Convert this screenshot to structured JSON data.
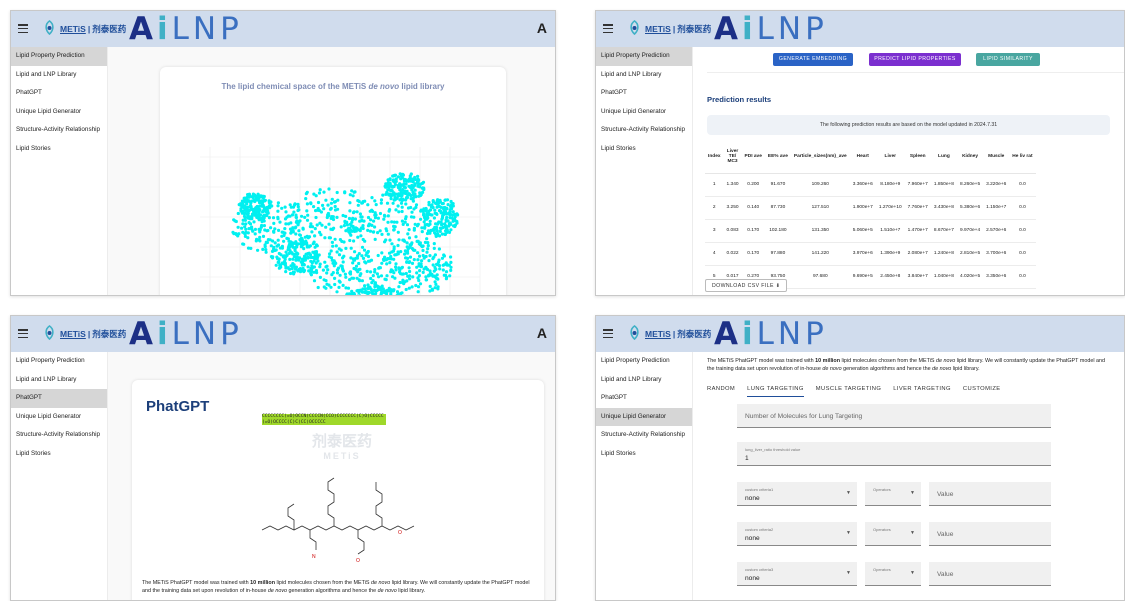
{
  "app": {
    "brand_en": "METiS",
    "brand_sep": "|",
    "brand_cn": "剂泰医药",
    "logo_text": "AiLNP",
    "account_icon": "A"
  },
  "sidebar": {
    "items": [
      {
        "label": "Lipid Property Prediction"
      },
      {
        "label": "Lipid and LNP Library"
      },
      {
        "label": "PhatGPT"
      },
      {
        "label": "Unique Lipid Generator"
      },
      {
        "label": "Structure-Activity Relationship"
      },
      {
        "label": "Lipid Stories"
      }
    ]
  },
  "panel1": {
    "chart_title_prefix": "The lipid chemical space of the METiS ",
    "chart_title_italic": "de novo",
    "chart_title_suffix": " lipid library",
    "point_color": "#00f0f0"
  },
  "panel2": {
    "buttons": [
      {
        "label": "GENERATE EMBEDDING",
        "color": "#2a63c6"
      },
      {
        "label": "PREDICT LIPID PROPERTIES",
        "color": "#7b2fcf"
      },
      {
        "label": "LIPID SIMILARITY",
        "color": "#49a6a0"
      }
    ],
    "results_title": "Prediction results",
    "info_text": "The following prediction results are based on the model updated in 2024.7.31",
    "table": {
      "headers": [
        "Index",
        "Liver TE/ MC3",
        "PDI ave",
        "EE% ave",
        "Particle_sizes(nm)_ave",
        "Heart",
        "Liver",
        "Spleen",
        "Lung",
        "Kidney",
        "Muscle",
        "He liv rat"
      ],
      "rows": [
        [
          "1",
          "1.340",
          "0.200",
          "91.670",
          "109.260",
          "3.360e+6",
          "8.180e+9",
          "7.960e+7",
          "1.850e+8",
          "8.260e+5",
          "3.220e+6",
          "0.0"
        ],
        [
          "2",
          "3.250",
          "0.140",
          "87.730",
          "127.510",
          "1.900e+7",
          "1.270e+10",
          "7.760e+7",
          "3.430e+8",
          "5.380e+6",
          "1.150e+7",
          "0.0"
        ],
        [
          "3",
          "0.083",
          "0.170",
          "102.180",
          "131.350",
          "5.060e+5",
          "1.510e+7",
          "1.470e+7",
          "8.670e+7",
          "9.970e+4",
          "2.570e+6",
          "0.0"
        ],
        [
          "4",
          "0.022",
          "0.170",
          "97.880",
          "141.220",
          "3.970e+6",
          "1.390e+9",
          "2.080e+7",
          "1.240e+8",
          "2.810e+5",
          "3.700e+6",
          "0.0"
        ],
        [
          "5",
          "0.017",
          "0.270",
          "93.750",
          "97.680",
          "9.690e+5",
          "2.450e+8",
          "3.840e+7",
          "1.040e+8",
          "4.020e+5",
          "3.350e+6",
          "0.0"
        ]
      ]
    },
    "download_label": "DOWNLOAD CSV FILE ⬇"
  },
  "panel3": {
    "title": "PhatGPT",
    "smiles": "CCCCCCCC(=O)OCCN(CCCCN(CCO)CCCCCCC(C)O)CCCCC(=O)OCCCC(C)C(CC)OCCCCC",
    "watermark_cn": "剂泰医药",
    "watermark_en": "METiS",
    "desc_1": "The METiS PhatGPT model was trained with ",
    "desc_bold": "10 million",
    "desc_2": " lipid molecules chosen from the METiS ",
    "desc_it1": "de novo",
    "desc_3": " lipid library. We will constantly update the PhatGPT model and the training data set upon revolution of in-house ",
    "desc_it2": "de novo",
    "desc_4": " generation algorithms and hence the ",
    "desc_it3": "de novo",
    "desc_5": " lipid library."
  },
  "panel4": {
    "tabs": [
      {
        "label": "RANDOM"
      },
      {
        "label": "LUNG TARGETING"
      },
      {
        "label": "MUSCLE TARGETING"
      },
      {
        "label": "LIVER TARGETING"
      },
      {
        "label": "CUSTOMIZE"
      }
    ],
    "num_placeholder": "Number of Molecules for Lung Targeting",
    "threshold_label": "lung_liver_ratio threshold value",
    "threshold_value": "1",
    "criteria": [
      {
        "label": "custom criteria1",
        "value": "none",
        "op_label": "Operators",
        "val_placeholder": "Value"
      },
      {
        "label": "custom criteria2",
        "value": "none",
        "op_label": "Operators",
        "val_placeholder": "Value"
      },
      {
        "label": "custom criteria3",
        "value": "none",
        "op_label": "Operators",
        "val_placeholder": "Value"
      }
    ]
  }
}
